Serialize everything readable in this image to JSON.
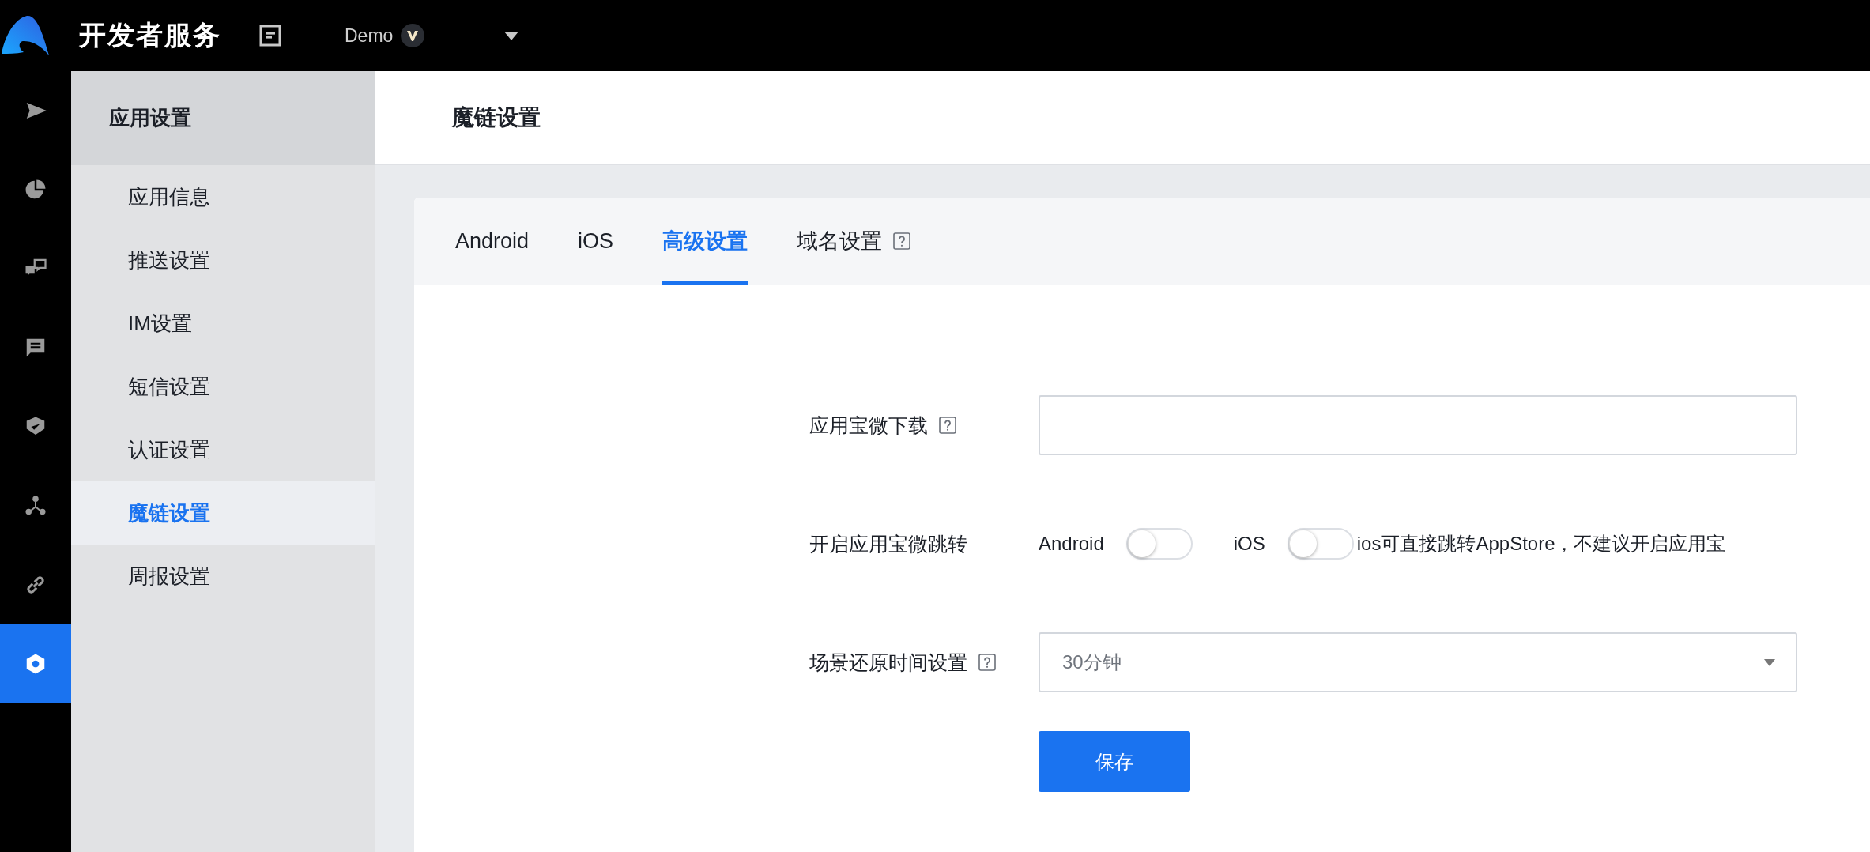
{
  "header": {
    "title": "开发者服务",
    "app_name": "Demo"
  },
  "rail": [
    {
      "selected": false
    },
    {
      "selected": false
    },
    {
      "selected": false
    },
    {
      "selected": false
    },
    {
      "selected": false
    },
    {
      "selected": false
    },
    {
      "selected": false
    },
    {
      "selected": true
    }
  ],
  "sidebar": {
    "title": "应用设置",
    "items": [
      {
        "label": "应用信息",
        "selected": false
      },
      {
        "label": "推送设置",
        "selected": false
      },
      {
        "label": "IM设置",
        "selected": false
      },
      {
        "label": "短信设置",
        "selected": false
      },
      {
        "label": "认证设置",
        "selected": false
      },
      {
        "label": "魔链设置",
        "selected": true
      },
      {
        "label": "周报设置",
        "selected": false
      }
    ]
  },
  "page_title": "魔链设置",
  "tabs": [
    {
      "label": "Android",
      "selected": false,
      "help": false
    },
    {
      "label": "iOS",
      "selected": false,
      "help": false
    },
    {
      "label": "高级设置",
      "selected": true,
      "help": false
    },
    {
      "label": "域名设置",
      "selected": false,
      "help": true
    }
  ],
  "form": [
    {
      "kind": "text",
      "label": "应用宝微下载",
      "help": true
    },
    {
      "kind": "toggles",
      "label": "开启应用宝微跳转",
      "help": false,
      "toggles": [
        {
          "label": "Android",
          "on": false
        },
        {
          "label": "iOS",
          "on": false
        }
      ],
      "note": "ios可直接跳转AppStore，不建议开启应用宝"
    },
    {
      "kind": "select",
      "label": "场景还原时间设置",
      "help": true,
      "value": "30分钟"
    }
  ],
  "save_button": "保存"
}
